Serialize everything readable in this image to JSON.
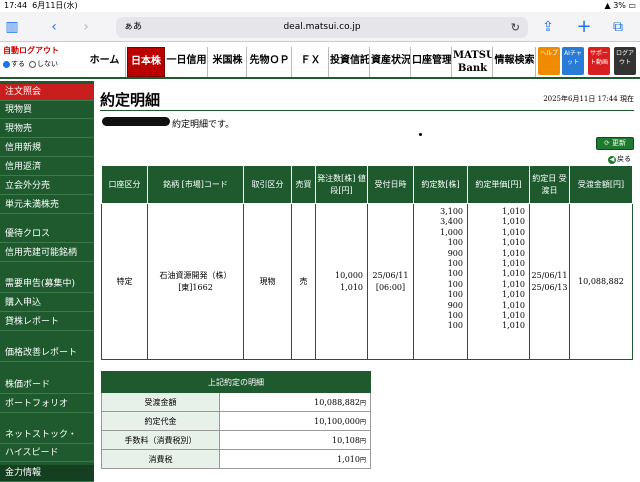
{
  "status_bar": {
    "time": "17:44",
    "date": "6月11日(水)",
    "battery": "3%"
  },
  "browser": {
    "text_size": "ぁあ",
    "url": "deal.matsui.co.jp"
  },
  "logout": {
    "title": "自動ログアウト",
    "on_label": "する",
    "off_label": "しない"
  },
  "nav": {
    "tabs": [
      "ホーム",
      "日本株",
      "一日信用",
      "米国株",
      "先物ＯＰ",
      "ＦＸ",
      "投資信託",
      "資産状況",
      "口座管理",
      "MATSUI Bank",
      "情報検索"
    ],
    "icons": [
      "ヘルプ",
      "AIチャット",
      "サポート動画",
      "ログアウト"
    ]
  },
  "sidebar": {
    "items": [
      "注文照会",
      "現物買",
      "現物売",
      "信用新規",
      "信用返済",
      "立会外分売",
      "単元未満株売",
      "優待クロス",
      "信用売建可能銘柄",
      "需要申告(募集中)",
      "購入申込",
      "貸株レポート",
      "価格改善レポート",
      "株価ボード",
      "ポートフォリオ",
      "ネットストック・",
      "ハイスピード",
      "金力情報"
    ]
  },
  "page": {
    "title": "約定明細",
    "date": "2025年6月11日 17:44 現在",
    "message": "約定明細です。",
    "update_button": "更新",
    "back_link": "戻る"
  },
  "table": {
    "headers": [
      "口座区分",
      "銘柄 [市場]コード",
      "取引区分",
      "売買",
      "発注数[株] 値段[円]",
      "受付日時",
      "約定数[株]",
      "約定単価[円]",
      "約定日 受渡日",
      "受渡金額[円]"
    ],
    "row": {
      "account": "特定",
      "stock_name": "石油資源開発（株）",
      "stock_code": "[東]1662",
      "trade_type": "現物",
      "side": "売",
      "order_qty": "10,000",
      "order_price": "1,010",
      "received_date": "25/06/11",
      "received_time": "[06:00]",
      "fill_qty": [
        "3,100",
        "3,400",
        "1,000",
        "100",
        "900",
        "100",
        "100",
        "100",
        "100",
        "900",
        "100",
        "100"
      ],
      "fill_price": [
        "1,010",
        "1,010",
        "1,010",
        "1,010",
        "1,010",
        "1,010",
        "1,010",
        "1,010",
        "1,010",
        "1,010",
        "1,010",
        "1,010"
      ],
      "trade_date": "25/06/11",
      "settle_date": "25/06/13",
      "settle_amount": "10,088,882"
    }
  },
  "summary": {
    "title": "上記約定の明細",
    "unit": "円",
    "rows": [
      {
        "label": "受渡金額",
        "value": "10,088,882"
      },
      {
        "label": "約定代金",
        "value": "10,100,000"
      },
      {
        "label": "手数料（消費税別）",
        "value": "10,108"
      },
      {
        "label": "消費税",
        "value": "1,010"
      }
    ]
  },
  "colors": {
    "nav_green": "#1e5a2e",
    "active_red": "#b00000",
    "link_blue": "#1a73e8"
  }
}
